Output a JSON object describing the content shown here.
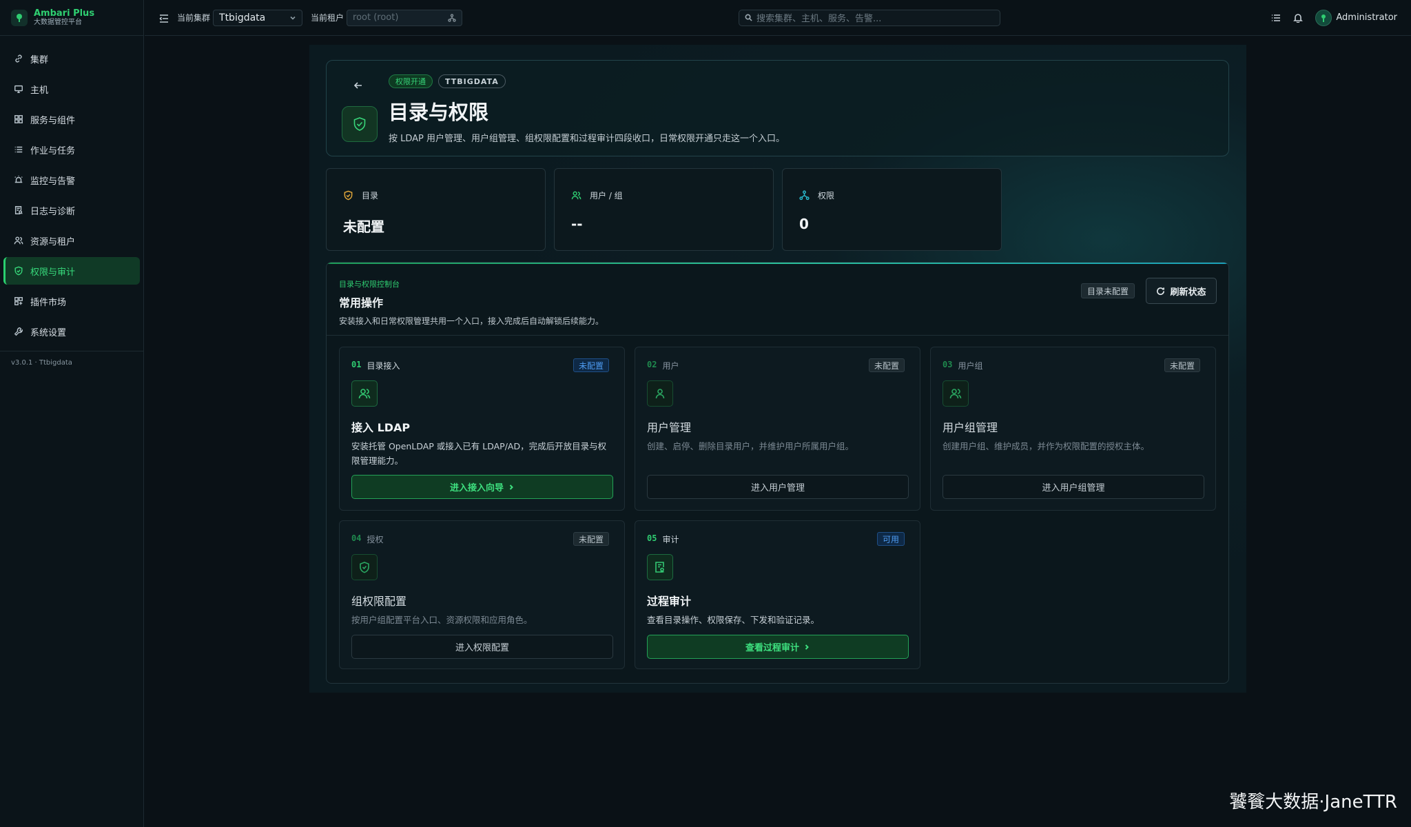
{
  "brand": {
    "name": "Ambari Plus",
    "subtitle": "大数据管控平台"
  },
  "sidebar": {
    "items": [
      {
        "label": "集群",
        "icon": "link-icon",
        "active": false
      },
      {
        "label": "主机",
        "icon": "monitor-icon",
        "active": false
      },
      {
        "label": "服务与组件",
        "icon": "grid-icon",
        "active": false
      },
      {
        "label": "作业与任务",
        "icon": "list-icon",
        "active": false
      },
      {
        "label": "监控与告警",
        "icon": "alarm-icon",
        "active": false
      },
      {
        "label": "日志与诊断",
        "icon": "log-search-icon",
        "active": false
      },
      {
        "label": "资源与租户",
        "icon": "users-icon",
        "active": true
      },
      {
        "label": "权限与审计",
        "icon": "shield-icon",
        "active": true
      },
      {
        "label": "插件市场",
        "icon": "plugin-icon",
        "active": false
      },
      {
        "label": "系统设置",
        "icon": "wrench-icon",
        "active": false
      }
    ],
    "version": "v3.0.1 · Ttbigdata"
  },
  "topbar": {
    "cluster_label": "当前集群",
    "cluster_value": "Ttbigdata",
    "tenant_label": "当前租户",
    "tenant_placeholder": "root (root)",
    "search_placeholder": "搜索集群、主机、服务、告警...",
    "user_name": "Administrator"
  },
  "hero": {
    "badge_1": "权限开通",
    "badge_2": "TTBIGDATA",
    "title": "目录与权限",
    "description": "按 LDAP 用户管理、用户组管理、组权限配置和过程审计四段收口，日常权限开通只走这一个入口。"
  },
  "stats": [
    {
      "label": "目录",
      "value": "未配置",
      "icon": "shield-icon",
      "color": "#e0a63a"
    },
    {
      "label": "用户 / 组",
      "value": "--",
      "icon": "users-icon",
      "color": "#2fcc71"
    },
    {
      "label": "权限",
      "value": "0",
      "icon": "network-icon",
      "color": "#29b6c9"
    }
  ],
  "console": {
    "kicker": "目录与权限控制台",
    "title": "常用操作",
    "description": "安装接入和日常权限管理共用一个入口，接入完成后自动解锁后续能力。",
    "status_chip": "目录未配置",
    "refresh_label": "刷新状态"
  },
  "cards": [
    {
      "num": "01",
      "category": "目录接入",
      "status": "未配置",
      "title": "接入 LDAP",
      "description": "安装托管 OpenLDAP 或接入已有 LDAP/AD，完成后开放目录与权限管理能力。",
      "button": "进入接入向导",
      "icon": "users-icon"
    },
    {
      "num": "02",
      "category": "用户",
      "status": "未配置",
      "title": "用户管理",
      "description": "创建、启停、删除目录用户，并维护用户所属用户组。",
      "button": "进入用户管理",
      "icon": "user-icon"
    },
    {
      "num": "03",
      "category": "用户组",
      "status": "未配置",
      "title": "用户组管理",
      "description": "创建用户组、维护成员，并作为权限配置的授权主体。",
      "button": "进入用户组管理",
      "icon": "users-icon"
    },
    {
      "num": "04",
      "category": "授权",
      "status": "未配置",
      "title": "组权限配置",
      "description": "按用户组配置平台入口、资源权限和应用角色。",
      "button": "进入权限配置",
      "icon": "shield-icon"
    },
    {
      "num": "05",
      "category": "审计",
      "status": "可用",
      "title": "过程审计",
      "description": "查看目录操作、权限保存、下发和验证记录。",
      "button": "查看过程审计",
      "icon": "audit-icon"
    }
  ],
  "watermark": "饕餮大数据·JaneTTR"
}
